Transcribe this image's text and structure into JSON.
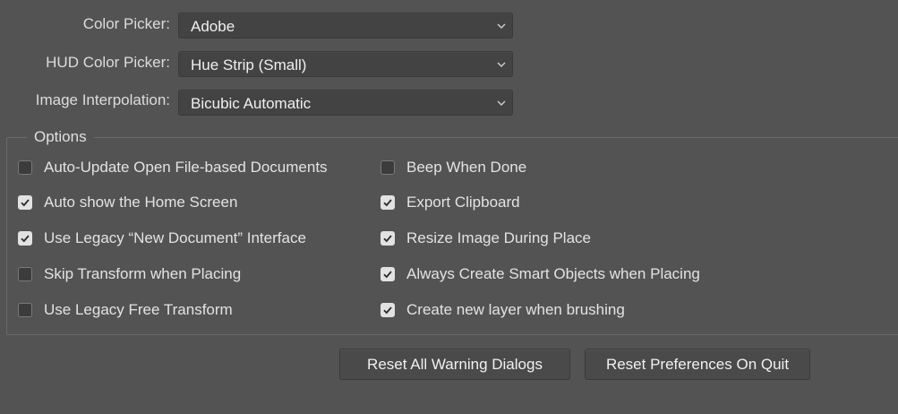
{
  "selects": {
    "color_picker": {
      "label": "Color Picker:",
      "value": "Adobe",
      "icon": "chevron-down-icon"
    },
    "hud_color_picker": {
      "label": "HUD Color Picker:",
      "value": "Hue Strip (Small)",
      "icon": "chevron-down-icon"
    },
    "image_interpolation": {
      "label": "Image Interpolation:",
      "value": "Bicubic Automatic",
      "icon": "chevron-down-icon"
    }
  },
  "options": {
    "title": "Options",
    "left": [
      {
        "label": "Auto-Update Open File-based Documents",
        "checked": false
      },
      {
        "label": "Auto show the Home Screen",
        "checked": true
      },
      {
        "label": "Use Legacy “New Document” Interface",
        "checked": true
      },
      {
        "label": "Skip Transform when Placing",
        "checked": false
      },
      {
        "label": "Use Legacy Free Transform",
        "checked": false
      }
    ],
    "right": [
      {
        "label": "Beep When Done",
        "checked": false
      },
      {
        "label": "Export Clipboard",
        "checked": true
      },
      {
        "label": "Resize Image During Place",
        "checked": true
      },
      {
        "label": "Always Create Smart Objects when Placing",
        "checked": true
      },
      {
        "label": "Create new layer when brushing",
        "checked": true
      }
    ]
  },
  "buttons": {
    "reset_warning": "Reset All Warning Dialogs",
    "reset_prefs": "Reset Preferences On Quit"
  }
}
